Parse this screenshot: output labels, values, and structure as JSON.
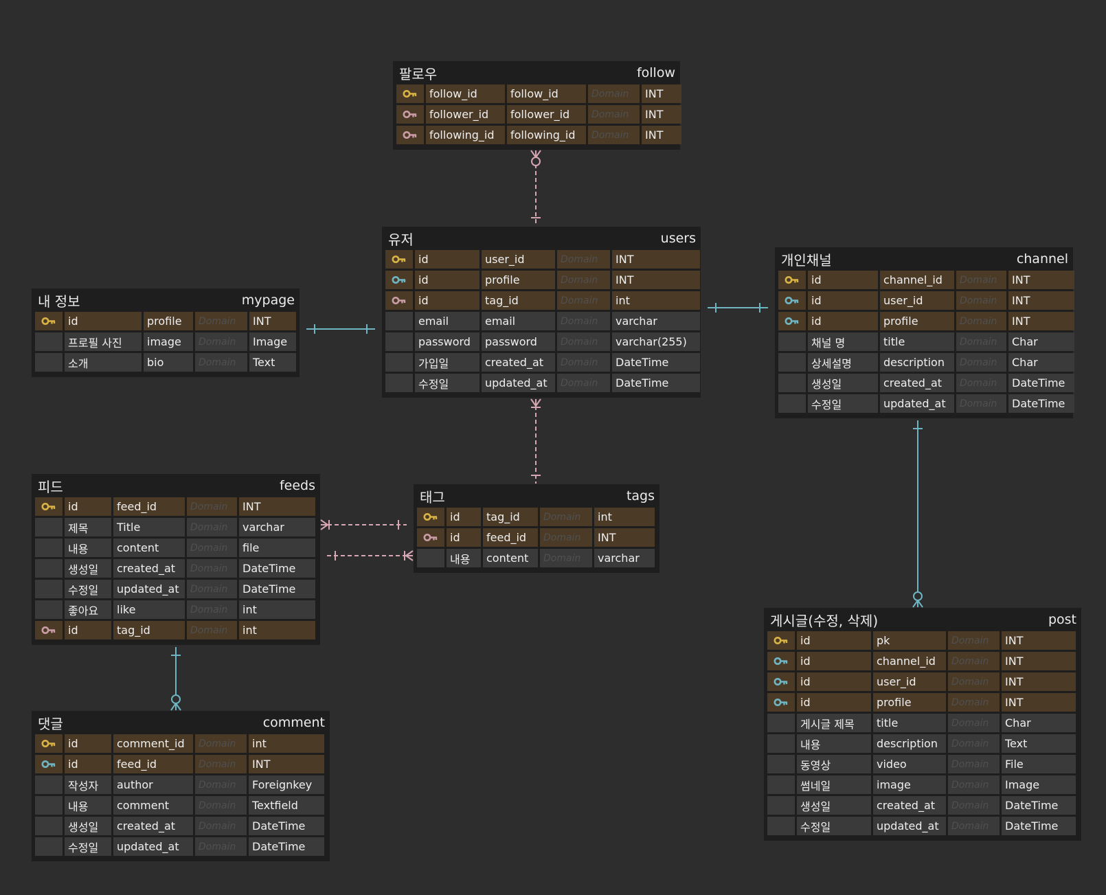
{
  "colors": {
    "background": "#2d2d2d",
    "entity": "#1e1e1e",
    "row": "#3a3a3a",
    "key_row": "#4b3a26",
    "primary_key": "#d9b445",
    "foreign_key_teal": "#6fb6c4",
    "foreign_key_pink": "#c99ca7",
    "edge_pink": "#d7a7b3",
    "edge_teal": "#6fb6c4"
  },
  "entities": [
    {
      "id": "follow",
      "logical": "팔로우",
      "physical": "follow",
      "rows": [
        {
          "key": "pk",
          "logical": "follow_id",
          "physical": "follow_id",
          "domain": "Domain",
          "type": "INT"
        },
        {
          "key": "fk-pink",
          "logical": "follower_id",
          "physical": "follower_id",
          "domain": "Domain",
          "type": "INT"
        },
        {
          "key": "fk-pink",
          "logical": "following_id",
          "physical": "following_id",
          "domain": "Domain",
          "type": "INT"
        }
      ]
    },
    {
      "id": "users",
      "logical": "유저",
      "physical": "users",
      "rows": [
        {
          "key": "pk",
          "logical": "id",
          "physical": "user_id",
          "domain": "Domain",
          "type": "INT"
        },
        {
          "key": "fk-teal",
          "logical": "id",
          "physical": "profile",
          "domain": "Domain",
          "type": "INT"
        },
        {
          "key": "fk-pink",
          "logical": "id",
          "physical": "tag_id",
          "domain": "Domain",
          "type": "int"
        },
        {
          "key": "",
          "logical": "email",
          "physical": "email",
          "domain": "Domain",
          "type": "varchar"
        },
        {
          "key": "",
          "logical": "password",
          "physical": "password",
          "domain": "Domain",
          "type": "varchar(255)"
        },
        {
          "key": "",
          "logical": "가입일",
          "physical": "created_at",
          "domain": "Domain",
          "type": "DateTime"
        },
        {
          "key": "",
          "logical": "수정일",
          "physical": "updated_at",
          "domain": "Domain",
          "type": "DateTime"
        }
      ]
    },
    {
      "id": "mypage",
      "logical": "내 정보",
      "physical": "mypage",
      "rows": [
        {
          "key": "pk",
          "logical": "id",
          "physical": "profile",
          "domain": "Domain",
          "type": "INT"
        },
        {
          "key": "",
          "logical": "프로필 사진",
          "physical": "image",
          "domain": "Domain",
          "type": "Image"
        },
        {
          "key": "",
          "logical": "소개",
          "physical": "bio",
          "domain": "Domain",
          "type": "Text"
        }
      ]
    },
    {
      "id": "channel",
      "logical": "개인채널",
      "physical": "channel",
      "rows": [
        {
          "key": "pk",
          "logical": "id",
          "physical": "channel_id",
          "domain": "Domain",
          "type": "INT"
        },
        {
          "key": "fk-teal",
          "logical": "id",
          "physical": "user_id",
          "domain": "Domain",
          "type": "INT"
        },
        {
          "key": "fk-teal",
          "logical": "id",
          "physical": "profile",
          "domain": "Domain",
          "type": "INT"
        },
        {
          "key": "",
          "logical": "채널 명",
          "physical": "title",
          "domain": "Domain",
          "type": "Char"
        },
        {
          "key": "",
          "logical": "상세설명",
          "physical": "description",
          "domain": "Domain",
          "type": "Char"
        },
        {
          "key": "",
          "logical": "생성일",
          "physical": "created_at",
          "domain": "Domain",
          "type": "DateTime"
        },
        {
          "key": "",
          "logical": "수정일",
          "physical": "updated_at",
          "domain": "Domain",
          "type": "DateTime"
        }
      ]
    },
    {
      "id": "feeds",
      "logical": "피드",
      "physical": "feeds",
      "rows": [
        {
          "key": "pk",
          "logical": "id",
          "physical": "feed_id",
          "domain": "Domain",
          "type": "INT"
        },
        {
          "key": "",
          "logical": "제목",
          "physical": "Title",
          "domain": "Domain",
          "type": "varchar"
        },
        {
          "key": "",
          "logical": "내용",
          "physical": "content",
          "domain": "Domain",
          "type": "file"
        },
        {
          "key": "",
          "logical": "생성일",
          "physical": "created_at",
          "domain": "Domain",
          "type": "DateTime"
        },
        {
          "key": "",
          "logical": "수정일",
          "physical": "updated_at",
          "domain": "Domain",
          "type": "DateTime"
        },
        {
          "key": "",
          "logical": "좋아요",
          "physical": "like",
          "domain": "Domain",
          "type": "int"
        },
        {
          "key": "fk-pink",
          "logical": "id",
          "physical": "tag_id",
          "domain": "Domain",
          "type": "int"
        }
      ]
    },
    {
      "id": "tags",
      "logical": "태그",
      "physical": "tags",
      "rows": [
        {
          "key": "pk",
          "logical": "id",
          "physical": "tag_id",
          "domain": "Domain",
          "type": "int"
        },
        {
          "key": "fk-pink",
          "logical": "id",
          "physical": "feed_id",
          "domain": "Domain",
          "type": "INT"
        },
        {
          "key": "",
          "logical": "내용",
          "physical": "content",
          "domain": "Domain",
          "type": "varchar"
        }
      ]
    },
    {
      "id": "comment",
      "logical": "댓글",
      "physical": "comment",
      "rows": [
        {
          "key": "pk",
          "logical": "id",
          "physical": "comment_id",
          "domain": "Domain",
          "type": "int"
        },
        {
          "key": "fk-teal",
          "logical": "id",
          "physical": "feed_id",
          "domain": "Domain",
          "type": "INT"
        },
        {
          "key": "",
          "logical": "작성자",
          "physical": "author",
          "domain": "Domain",
          "type": "Foreignkey"
        },
        {
          "key": "",
          "logical": "내용",
          "physical": "comment",
          "domain": "Domain",
          "type": "Textfield"
        },
        {
          "key": "",
          "logical": "생성일",
          "physical": "created_at",
          "domain": "Domain",
          "type": "DateTime"
        },
        {
          "key": "",
          "logical": "수정일",
          "physical": "updated_at",
          "domain": "Domain",
          "type": "DateTime"
        }
      ]
    },
    {
      "id": "post",
      "logical": "게시글(수정, 삭제)",
      "physical": "post",
      "rows": [
        {
          "key": "pk",
          "logical": "id",
          "physical": "pk",
          "domain": "Domain",
          "type": "INT"
        },
        {
          "key": "fk-teal",
          "logical": "id",
          "physical": "channel_id",
          "domain": "Domain",
          "type": "INT"
        },
        {
          "key": "fk-teal",
          "logical": "id",
          "physical": "user_id",
          "domain": "Domain",
          "type": "INT"
        },
        {
          "key": "fk-teal",
          "logical": "id",
          "physical": "profile",
          "domain": "Domain",
          "type": "INT"
        },
        {
          "key": "",
          "logical": "게시글 제목",
          "physical": "title",
          "domain": "Domain",
          "type": "Char"
        },
        {
          "key": "",
          "logical": "내용",
          "physical": "description",
          "domain": "Domain",
          "type": "Text"
        },
        {
          "key": "",
          "logical": "동영상",
          "physical": "video",
          "domain": "Domain",
          "type": "File"
        },
        {
          "key": "",
          "logical": "썸네일",
          "physical": "image",
          "domain": "Domain",
          "type": "Image"
        },
        {
          "key": "",
          "logical": "생성일",
          "physical": "created_at",
          "domain": "Domain",
          "type": "DateTime"
        },
        {
          "key": "",
          "logical": "수정일",
          "physical": "updated_at",
          "domain": "Domain",
          "type": "DateTime"
        }
      ]
    }
  ],
  "relationships": [
    {
      "from": "follow",
      "to": "users",
      "style": "dashed",
      "color": "pink",
      "from_end": "zero-many",
      "to_end": "one"
    },
    {
      "from": "users",
      "to": "mypage",
      "style": "solid",
      "color": "teal",
      "from_end": "one",
      "to_end": "one"
    },
    {
      "from": "users",
      "to": "channel",
      "style": "solid",
      "color": "teal",
      "from_end": "one",
      "to_end": "one"
    },
    {
      "from": "users",
      "to": "tags",
      "style": "dashed",
      "color": "pink",
      "from_end": "many",
      "to_end": "one"
    },
    {
      "from": "feeds",
      "to": "tags",
      "style": "dashed",
      "color": "pink",
      "from_end": "many",
      "to_end": "one"
    },
    {
      "from": "feeds",
      "to": "tags",
      "style": "dashed",
      "color": "pink",
      "from_end": "one",
      "to_end": "many"
    },
    {
      "from": "feeds",
      "to": "comment",
      "style": "solid",
      "color": "teal",
      "from_end": "one",
      "to_end": "zero-many"
    },
    {
      "from": "channel",
      "to": "post",
      "style": "solid",
      "color": "teal",
      "from_end": "one",
      "to_end": "zero-many"
    }
  ]
}
